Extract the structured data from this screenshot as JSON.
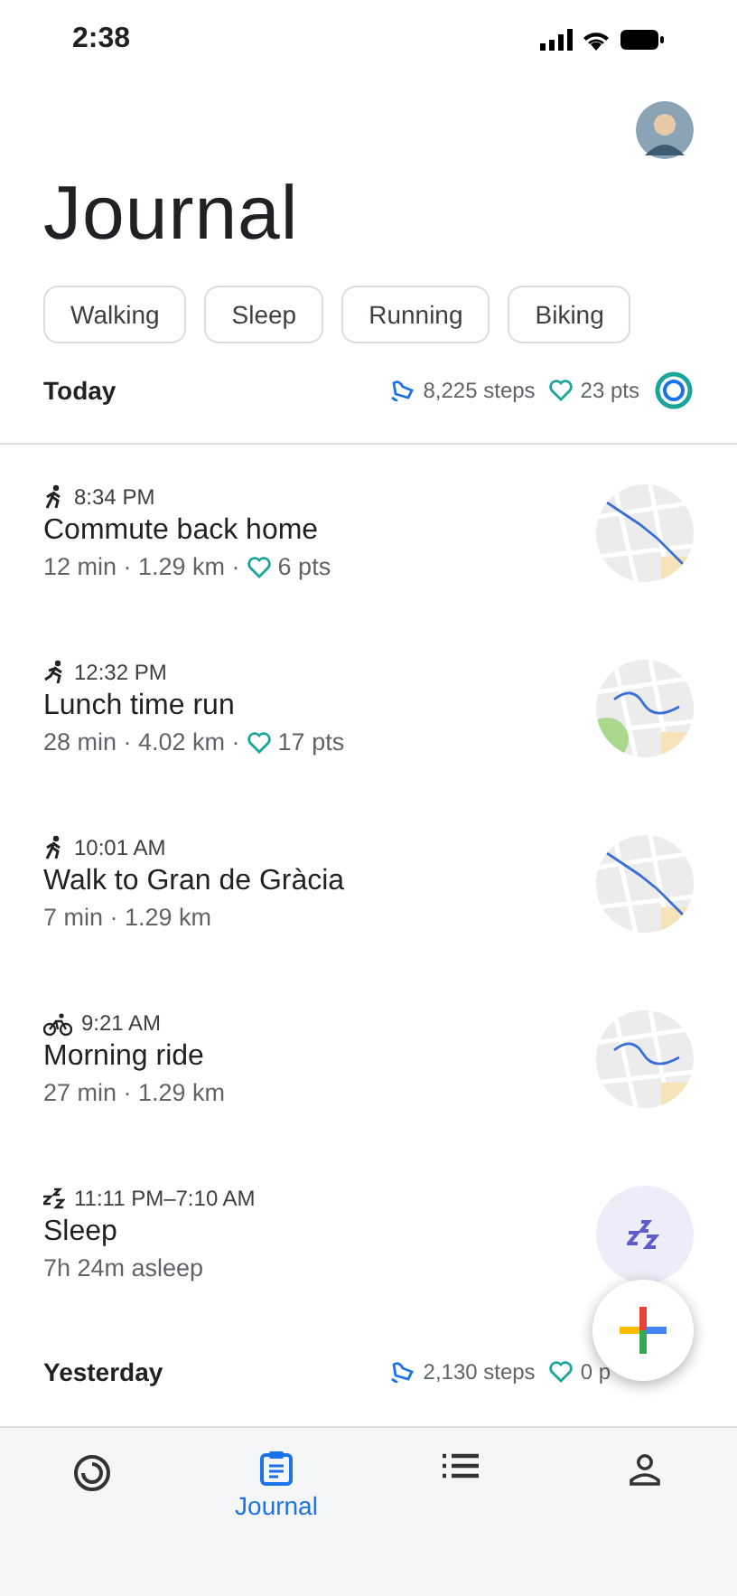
{
  "status_bar": {
    "time": "2:38"
  },
  "title": "Journal",
  "chips": [
    {
      "label": "Walking",
      "selected": false
    },
    {
      "label": "Sleep",
      "selected": false
    },
    {
      "label": "Running",
      "selected": false
    },
    {
      "label": "Biking",
      "selected": false
    }
  ],
  "today": {
    "label": "Today",
    "steps": "8,225 steps",
    "points": "23 pts"
  },
  "entries": [
    {
      "kind": "walk",
      "time": "8:34 PM",
      "title": "Commute back home",
      "details": "12 min · 1.29 km ·",
      "points": "6 pts"
    },
    {
      "kind": "run",
      "time": "12:32 PM",
      "title": "Lunch time run",
      "details": "28 min · 4.02 km ·",
      "points": "17 pts"
    },
    {
      "kind": "walk",
      "time": "10:01 AM",
      "title": "Walk to Gran de Gràcia",
      "details": "7 min · 1.29 km"
    },
    {
      "kind": "bike",
      "time": "9:21 AM",
      "title": "Morning ride",
      "details": "27 min · 1.29 km"
    },
    {
      "kind": "sleep",
      "time": "11:11 PM–7:10 AM",
      "title": "Sleep",
      "details": "7h 24m asleep"
    }
  ],
  "yesterday": {
    "label": "Yesterday",
    "steps": "2,130 steps",
    "points": "0 p"
  },
  "nav": [
    {
      "kind": "home",
      "selected": false
    },
    {
      "kind": "journal",
      "label": "Journal",
      "selected": true
    },
    {
      "kind": "browse",
      "selected": false
    },
    {
      "kind": "profile",
      "selected": false
    }
  ]
}
